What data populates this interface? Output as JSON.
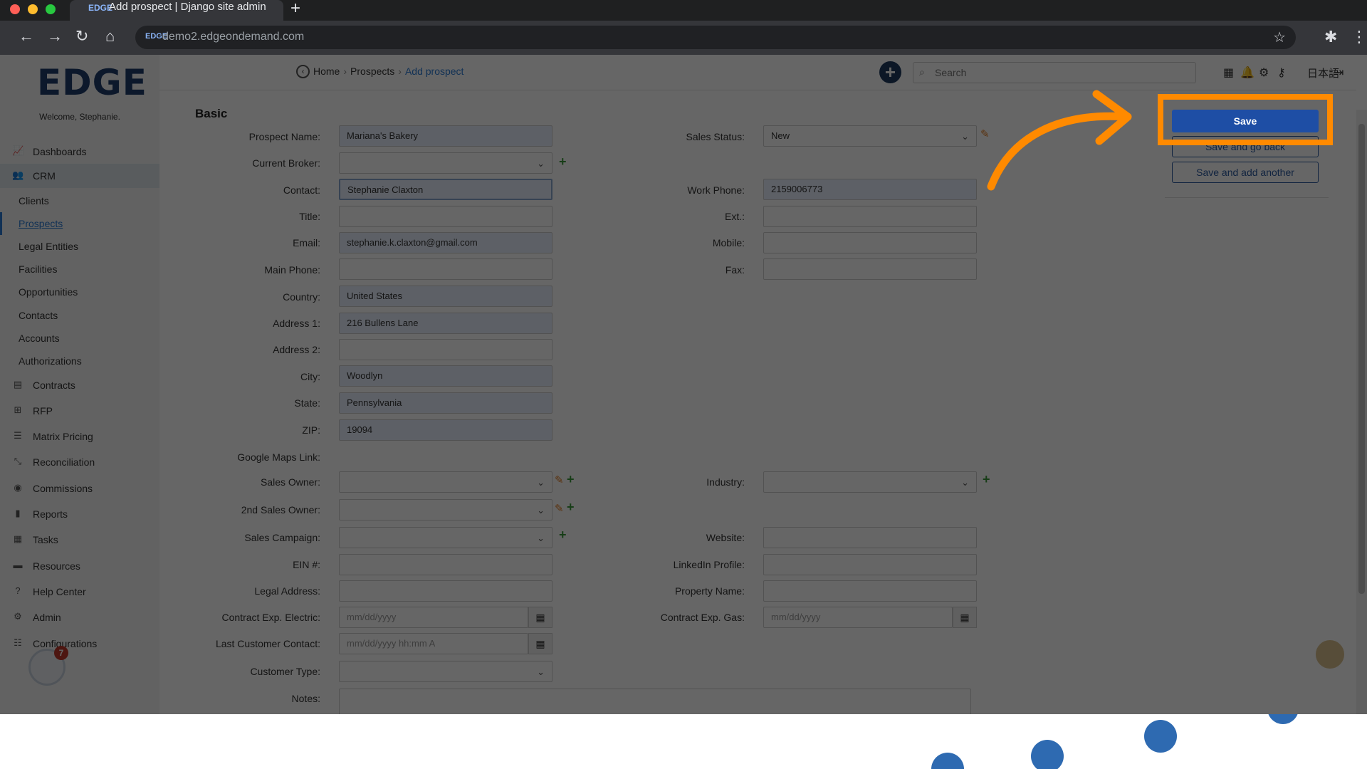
{
  "browser": {
    "tab_title": "Add prospect | Django site admin",
    "url": "demo2.edgeondemand.com"
  },
  "app": {
    "logo": "EDGE",
    "welcome": "Welcome, Stephanie.",
    "breadcrumb": {
      "home": "Home",
      "prospects": "Prospects",
      "current": "Add prospect"
    },
    "search_placeholder": "Search",
    "language": "日本語"
  },
  "sidebar": {
    "items": [
      {
        "label": "Dashboards",
        "icon": "chart-line-icon"
      },
      {
        "label": "CRM",
        "icon": "users-icon"
      },
      {
        "label": "Contracts",
        "icon": "file-icon"
      },
      {
        "label": "RFP",
        "icon": "sitemap-icon"
      },
      {
        "label": "Matrix Pricing",
        "icon": "list-icon"
      },
      {
        "label": "Reconciliation",
        "icon": "compress-icon"
      },
      {
        "label": "Commissions",
        "icon": "coins-icon"
      },
      {
        "label": "Reports",
        "icon": "bar-chart-icon"
      },
      {
        "label": "Tasks",
        "icon": "calendar-check-icon"
      },
      {
        "label": "Resources",
        "icon": "folder-icon"
      },
      {
        "label": "Help Center",
        "icon": "question-icon"
      },
      {
        "label": "Admin",
        "icon": "cogs-icon"
      },
      {
        "label": "Configurations",
        "icon": "sliders-icon"
      }
    ],
    "crm_sub": [
      "Clients",
      "Prospects",
      "Legal Entities",
      "Facilities",
      "Opportunities",
      "Contacts",
      "Accounts",
      "Authorizations"
    ],
    "help_count": "7"
  },
  "form": {
    "section": "Basic",
    "labels": {
      "prospect_name": "Prospect Name:",
      "current_broker": "Current Broker:",
      "contact": "Contact:",
      "title": "Title:",
      "email": "Email:",
      "main_phone": "Main Phone:",
      "country": "Country:",
      "address1": "Address 1:",
      "address2": "Address 2:",
      "city": "City:",
      "state": "State:",
      "zip": "ZIP:",
      "google_maps": "Google Maps Link:",
      "sales_owner": "Sales Owner:",
      "sales_owner2": "2nd Sales Owner:",
      "sales_campaign": "Sales Campaign:",
      "ein": "EIN #:",
      "legal_address": "Legal Address:",
      "contract_exp_electric": "Contract Exp. Electric:",
      "last_customer_contact": "Last Customer Contact:",
      "customer_type": "Customer Type:",
      "notes": "Notes:",
      "sales_status": "Sales Status:",
      "work_phone": "Work Phone:",
      "ext": "Ext.:",
      "mobile": "Mobile:",
      "fax": "Fax:",
      "industry": "Industry:",
      "website": "Website:",
      "linkedin": "LinkedIn Profile:",
      "property_name": "Property Name:",
      "contract_exp_gas": "Contract Exp. Gas:"
    },
    "values": {
      "prospect_name": "Mariana's Bakery",
      "contact": "Stephanie Claxton",
      "email": "stephanie.k.claxton@gmail.com",
      "country": "United States",
      "address1": "216 Bullens Lane",
      "city": "Woodlyn",
      "state": "Pennsylvania",
      "zip": "19094",
      "sales_status": "New",
      "work_phone": "2159006773"
    },
    "placeholders": {
      "date": "mm/dd/yyyy",
      "datetime": "mm/dd/yyyy hh:mm A"
    }
  },
  "actions": {
    "save": "Save",
    "save_go_back": "Save and go back",
    "save_add_another": "Save and add another"
  },
  "colors": {
    "highlight": "#ff8a00",
    "primary": "#1e4ea5"
  }
}
